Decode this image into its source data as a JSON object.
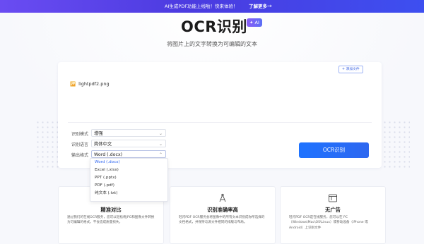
{
  "banner": {
    "message": "AI生成PDF功能上线啦！快来体验！",
    "link_label": "了解更多",
    "arrow": "→"
  },
  "hero": {
    "title": "OCR识别",
    "badge": "✦ AI",
    "subtitle": "将图片上的文字转换为可编辑的文本"
  },
  "upload": {
    "add_file_label": "+ 添加文件",
    "file_name": "lightpdf2.png"
  },
  "form": {
    "mode_label": "识别模式",
    "mode_value": "增强",
    "language_label": "识别语言",
    "language_value": "简体中文",
    "format_label": "输出格式",
    "format_value": "Word (.docx)",
    "format_options": [
      "Word (.docx)",
      "Excel (.xlsx)",
      "PPT (.pptx)",
      "PDF (.pdf)",
      "纯文本 (.txt)"
    ]
  },
  "actions": {
    "ocr_button": "OCR识别"
  },
  "features": [
    {
      "title": "精准对比",
      "desc": "通过我们的在线OCR服务，您可以轻松将JPG和图像文件转换为可编辑的格式，不会造成质量损失。",
      "icon": "compare-icon"
    },
    {
      "title": "识别准确率高",
      "desc": "轻闪PDF OCR服务会将图像中的所有文本识别成你所选择的文档格式，并保持与源文件相同的排版与布局。",
      "icon": "compass-icon"
    },
    {
      "title": "无广告",
      "desc": "轻闪PDF OCR是在线服务，您可以在 PC（Windows\\Mac\\OS\\Linux）或移动设备（iPhone 或 Android）上识别文件",
      "icon": "no-ads-icon"
    }
  ],
  "colors": {
    "accent": "#2b63f0",
    "banner_start": "#6a4cf2",
    "banner_end": "#3d4ff0"
  }
}
